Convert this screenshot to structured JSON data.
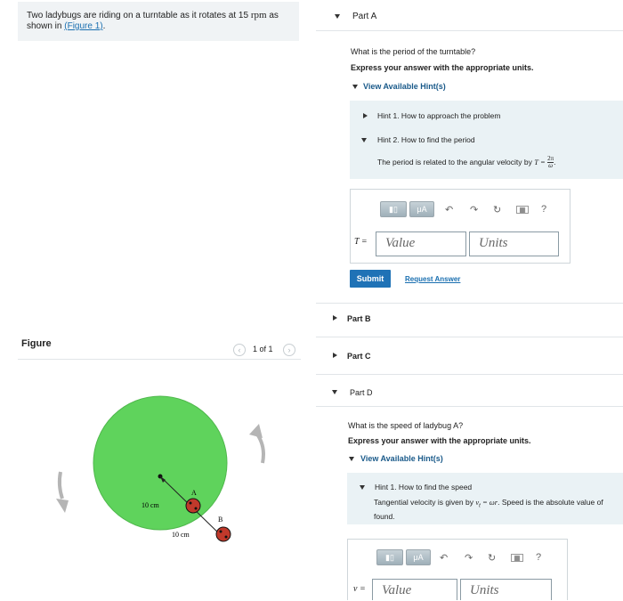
{
  "problem": {
    "text_before": "Two ladybugs are riding on a turntable as it rotates at 15",
    "unit": "rpm",
    "text_as": "as",
    "text_shown": "shown in",
    "figure_link": "(Figure 1)",
    "text_end": "."
  },
  "figure_panel": {
    "label": "Figure",
    "pager": "1 of 1",
    "prev_icon": "chevron-left-icon",
    "next_icon": "chevron-right-icon",
    "dim_left": "10 cm",
    "dim_right": "10 cm",
    "label_a": "A",
    "label_b": "B",
    "disk_color": "#5fd35c"
  },
  "part_a": {
    "title": "Part A",
    "question": "What is the period of the turntable?",
    "instruction": "Express your answer with the appropriate units.",
    "hints_toggle": "View Available Hint(s)",
    "hint1": "Hint 1. How to approach the problem",
    "hint2": "Hint 2. How to find the period",
    "hint2_body": "The period is related to the angular velocity by",
    "hint2_formula_lhs": "T =",
    "hint2_formula_num": "2π",
    "hint2_formula_den": "ω",
    "var_label": "T =",
    "value_placeholder": "Value",
    "units_placeholder": "Units",
    "toolbar_mu": "μA",
    "toolbar_help": "?",
    "submit": "Submit",
    "request_answer": "Request Answer"
  },
  "part_b": {
    "title": "Part B"
  },
  "part_c": {
    "title": "Part C"
  },
  "part_d": {
    "title": "Part D",
    "question": "What is the speed of ladybug A?",
    "instruction": "Express your answer with the appropriate units.",
    "hints_toggle": "View Available Hint(s)",
    "hint1": "Hint 1. How to find the speed",
    "hint1_body_a": "Tangential velocity is given by",
    "hint1_formula": "v",
    "hint1_formula_sub": "t",
    "hint1_formula_rhs": " = ωr",
    "hint1_body_b": ". Speed is the absolute value of",
    "hint1_body_c": "found.",
    "var_label": "v =",
    "value_placeholder": "Value",
    "units_placeholder": "Units",
    "toolbar_mu": "μA",
    "toolbar_help": "?"
  }
}
